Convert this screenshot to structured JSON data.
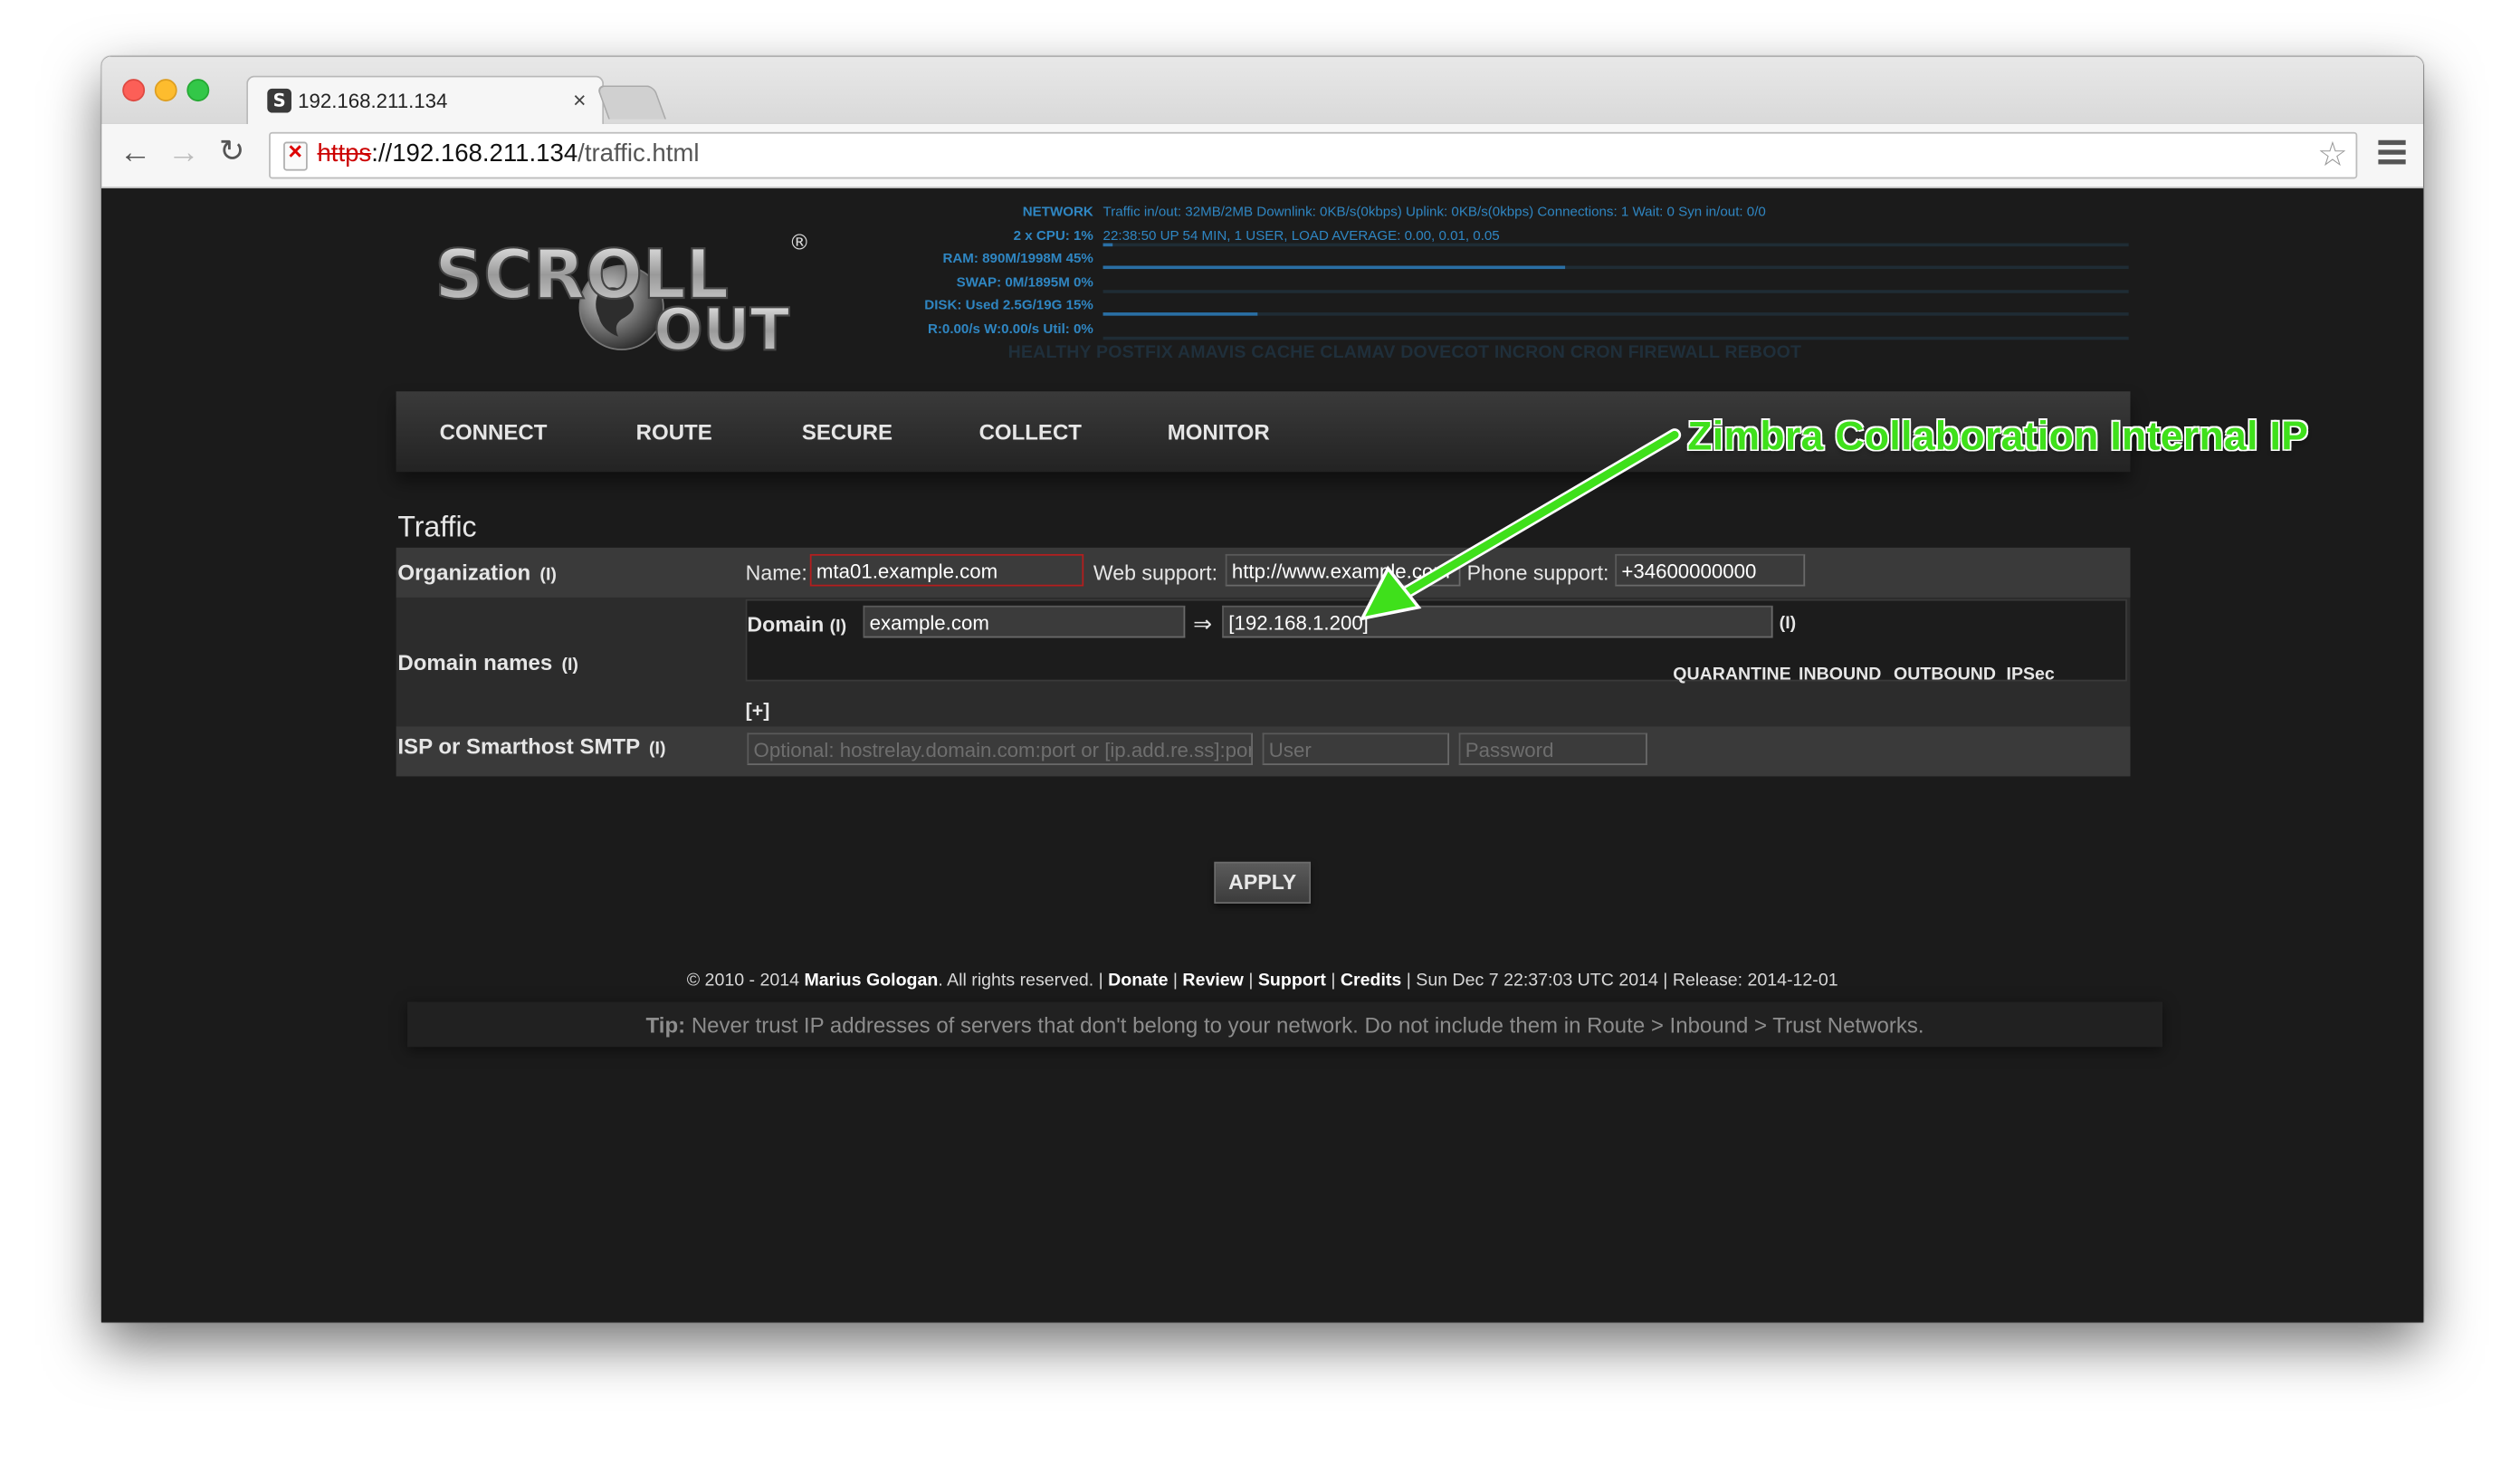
{
  "browser": {
    "tab_title": "192.168.211.134",
    "tab_favicon": "S",
    "close_tab": "×",
    "url_scheme": "https",
    "url_rest": "://192.168.211.134",
    "url_path": "/traffic.html"
  },
  "stats": [
    {
      "label": "NETWORK",
      "value": "Traffic in/out: 32MB/2MB  Downlink: 0KB/s(0kbps)  Uplink: 0KB/s(0kbps)  Connections: 1  Wait: 0  Syn in/out: 0/0",
      "fill": 0
    },
    {
      "label": "2 x CPU: 1%",
      "value": "22:38:50 UP 54 MIN, 1 USER, LOAD AVERAGE: 0.00, 0.01, 0.05",
      "fill": 0.01
    },
    {
      "label": "RAM: 890M/1998M 45%",
      "value": "",
      "fill": 0.45
    },
    {
      "label": "SWAP: 0M/1895M 0%",
      "value": "",
      "fill": 0
    },
    {
      "label": "DISK: Used 2.5G/19G 15%",
      "value": "",
      "fill": 0.15
    },
    {
      "label": "R:0.00/s W:0.00/s Util: 0%",
      "value": "",
      "fill": 0
    }
  ],
  "health_line": "HEALTHY  POSTFIX AMAVIS CACHE CLAMAV DOVECOT INCRON CRON FIREWALL REBOOT",
  "logo": {
    "line1": "SCROLL",
    "line2": "OUT",
    "mark": "®"
  },
  "menu": [
    "CONNECT",
    "ROUTE",
    "SECURE",
    "COLLECT",
    "MONITOR"
  ],
  "page_title": "Traffic",
  "form": {
    "organization": {
      "label": "Organization",
      "info": "(I)",
      "name_label": "Name:",
      "name_value": "mta01.example.com",
      "web_label": "Web support:",
      "web_value": "http://www.example.com",
      "phone_label": "Phone support:",
      "phone_value": "+34600000000"
    },
    "domains": {
      "label": "Domain names",
      "info": "(I)",
      "domain_label": "Domain",
      "domain_info": "(I)",
      "domain_value": "example.com",
      "arrow": "⇒",
      "target_value": "[192.168.1.200]",
      "target_info": "(I)",
      "options": [
        "QUARANTINE",
        "INBOUND",
        "OUTBOUND",
        "IPSec"
      ],
      "add": "[+]"
    },
    "isp": {
      "label": "ISP or Smarthost SMTP",
      "info": "(I)",
      "host_placeholder": "Optional: hostrelay.domain.com:port or [ip.add.re.ss]:port",
      "user_placeholder": "User",
      "password_placeholder": "Password"
    }
  },
  "apply_label": "APPLY",
  "footer": {
    "copyright": "© 2010 - 2014 ",
    "author": "Marius Gologan",
    "rights": ". All rights reserved. | ",
    "donate": "Donate",
    "sep": " | ",
    "review": "Review",
    "support": "Support",
    "credits": "Credits",
    "tail": " | Sun Dec 7 22:37:03 UTC 2014 | Release: 2014-12-01"
  },
  "tip": {
    "label": "Tip:",
    "text": " Never trust IP addresses of servers that don't belong to your network. Do not include them in Route > Inbound > Trust Networks."
  },
  "annotation": "Zimbra Collaboration Internal IP",
  "colors": {
    "annotation": "#3fe01b",
    "stats_blue": "#2f86c2",
    "name_border": "#b41e1e"
  }
}
